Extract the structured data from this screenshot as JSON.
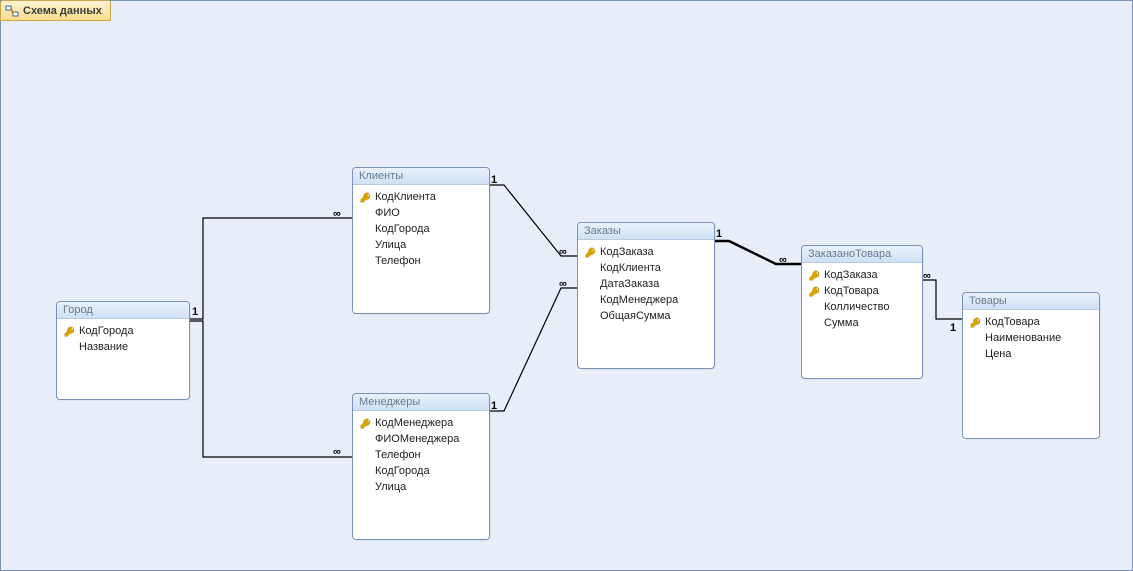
{
  "tab": {
    "label": "Схема данных"
  },
  "labels": {
    "one": "1",
    "many": "∞"
  },
  "tables": {
    "gorod": {
      "title": "Город",
      "fields": [
        {
          "name": "КодГорода",
          "pk": true
        },
        {
          "name": "Название",
          "pk": false
        }
      ]
    },
    "klienty": {
      "title": "Клиенты",
      "fields": [
        {
          "name": "КодКлиента",
          "pk": true
        },
        {
          "name": "ФИО",
          "pk": false
        },
        {
          "name": "КодГорода",
          "pk": false
        },
        {
          "name": "Улица",
          "pk": false
        },
        {
          "name": "Телефон",
          "pk": false
        }
      ]
    },
    "menedzhery": {
      "title": "Менеджеры",
      "fields": [
        {
          "name": "КодМенеджера",
          "pk": true
        },
        {
          "name": "ФИОМенеджера",
          "pk": false
        },
        {
          "name": "Телефон",
          "pk": false
        },
        {
          "name": "КодГорода",
          "pk": false
        },
        {
          "name": "Улица",
          "pk": false
        }
      ]
    },
    "zakazy": {
      "title": "Заказы",
      "fields": [
        {
          "name": "КодЗаказа",
          "pk": true
        },
        {
          "name": "КодКлиента",
          "pk": false
        },
        {
          "name": "ДатаЗаказа",
          "pk": false
        },
        {
          "name": "КодМенеджера",
          "pk": false
        },
        {
          "name": "ОбщаяСумма",
          "pk": false
        }
      ]
    },
    "zakazanotovara": {
      "title": "ЗаказаноТовара",
      "fields": [
        {
          "name": "КодЗаказа",
          "pk": true
        },
        {
          "name": "КодТовара",
          "pk": true
        },
        {
          "name": "Колличество",
          "pk": false
        },
        {
          "name": "Сумма",
          "pk": false
        }
      ]
    },
    "tovary": {
      "title": "Товары",
      "fields": [
        {
          "name": "КодТовара",
          "pk": true
        },
        {
          "name": "Наименование",
          "pk": false
        },
        {
          "name": "Цена",
          "pk": false
        }
      ]
    }
  }
}
